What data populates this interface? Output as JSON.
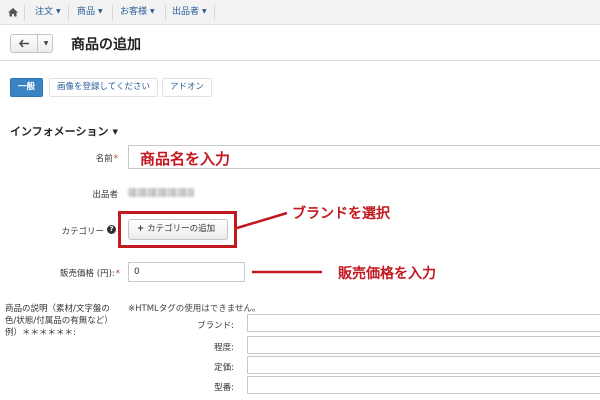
{
  "nav": {
    "items": [
      {
        "label": "注文"
      },
      {
        "label": "商品"
      },
      {
        "label": "お客様"
      },
      {
        "label": "出品者"
      }
    ]
  },
  "header": {
    "title": "商品の追加"
  },
  "tabs": [
    {
      "label": "一般",
      "active": true
    },
    {
      "label": "画像を登録してください",
      "active": false
    },
    {
      "label": "アドオン",
      "active": false
    }
  ],
  "section": {
    "title": "インフォメーション"
  },
  "form": {
    "name_label": "名前",
    "required_mark": "*",
    "seller_label": "出品者",
    "category_label": "カテゴリー",
    "category_button": "カテゴリーの追加",
    "price_label": "販売価格 (円):",
    "price_value": "0",
    "description_label": "商品の説明（素材/文字盤の色/状態/付属品の有無など）例）＊＊＊＊＊＊:",
    "html_note": "※HTMLタグの使用はできません。",
    "sub_fields": [
      {
        "label": "ブランド:"
      },
      {
        "label": "程度:"
      },
      {
        "label": "定価:"
      },
      {
        "label": "型番:"
      }
    ]
  },
  "annotations": {
    "name_hint": "商品名を入力",
    "brand_hint": "ブランドを選択",
    "price_hint": "販売価格を入力"
  },
  "colors": {
    "accent": "#3a84c4",
    "annotation": "#c2181f",
    "link": "#2a5c9a"
  }
}
